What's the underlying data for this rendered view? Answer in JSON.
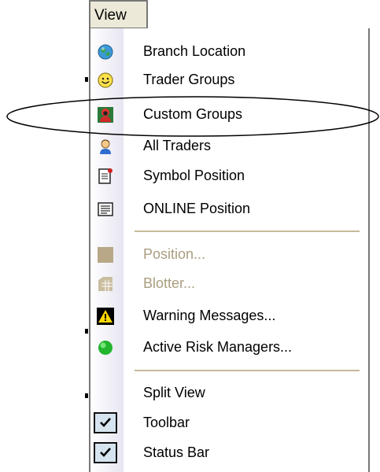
{
  "menu": {
    "title": "View",
    "items": [
      {
        "label": "Branch Location",
        "icon": "globe-icon"
      },
      {
        "label": "Trader Groups",
        "icon": "smiley-icon"
      },
      {
        "label": "Custom Groups",
        "icon": "group-avatar-icon"
      },
      {
        "label": "All Traders",
        "icon": "trader-person-icon"
      },
      {
        "label": "Symbol Position",
        "icon": "document-flag-icon"
      },
      {
        "label": "ONLINE Position",
        "icon": "document-lines-icon"
      },
      {
        "label": "Position...",
        "icon": "position-square-icon",
        "disabled": true
      },
      {
        "label": "Blotter...",
        "icon": "blotter-table-icon",
        "disabled": true
      },
      {
        "label": "Warning Messages...",
        "icon": "warning-triangle-icon"
      },
      {
        "label": "Active Risk Managers...",
        "icon": "green-ball-icon"
      },
      {
        "label": "Split View",
        "icon": ""
      },
      {
        "label": "Toolbar",
        "icon": "checkmark-icon",
        "checked": true
      },
      {
        "label": "Status Bar",
        "icon": "checkmark-icon",
        "checked": true
      }
    ]
  },
  "colors": {
    "disabled_text": "#aa9d80",
    "separator": "#c7b999",
    "checkbox_bg": "#d6e4f0"
  }
}
